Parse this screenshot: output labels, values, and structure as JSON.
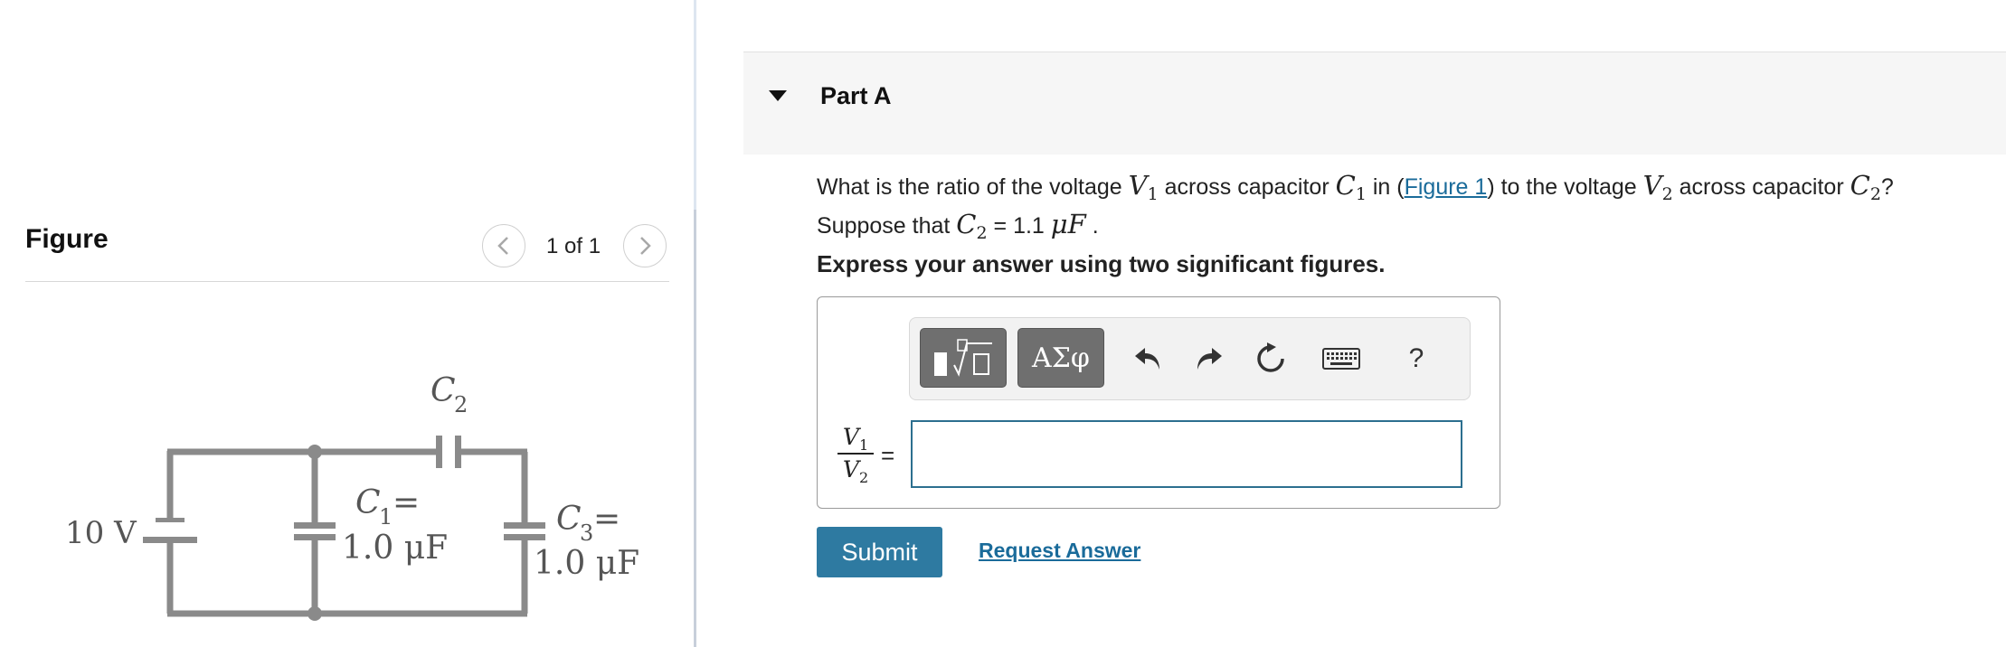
{
  "figure": {
    "title": "Figure",
    "pager": "1 of 1",
    "circuit": {
      "source_label": "10 V",
      "c2_label": "C",
      "c2_sub": "2",
      "c1_label_line1": "C",
      "c1_sub": "1",
      "c1_eq": " =",
      "c1_value": "1.0 μF",
      "c3_label_line1": "C",
      "c3_sub": "3",
      "c3_eq": " =",
      "c3_value": "1.0 μF"
    }
  },
  "part": {
    "title": "Part A"
  },
  "question": {
    "t1": "What is the ratio of the voltage ",
    "v1": "V",
    "v1_sub": "1",
    "t2": " across capacitor ",
    "c1": "C",
    "c1_sub": "1",
    "t3": " in (",
    "figure_link": "Figure 1",
    "t4": ") to the voltage ",
    "v2": "V",
    "v2_sub": "2",
    "t5": " across capacitor ",
    "c2": "C",
    "c2_sub": "2",
    "t6": "?",
    "t7": "Suppose that ",
    "c2b": "C",
    "c2b_sub": "2",
    "t8": " = 1.1  ",
    "unit": "μF",
    "t9": " ."
  },
  "instruction": "Express your answer using two significant figures.",
  "answer": {
    "frac_num": "V",
    "frac_num_sub": "1",
    "frac_den": "V",
    "frac_den_sub": "2",
    "equals": "=",
    "input_value": "",
    "toolbar": {
      "symbols_label": "ΑΣφ",
      "help_label": "?"
    }
  },
  "actions": {
    "submit_label": "Submit",
    "request_answer_label": "Request Answer"
  },
  "colors": {
    "accent": "#2e7aa1",
    "link": "#1a6b9a",
    "circuit_wire": "#8a8a8a"
  }
}
